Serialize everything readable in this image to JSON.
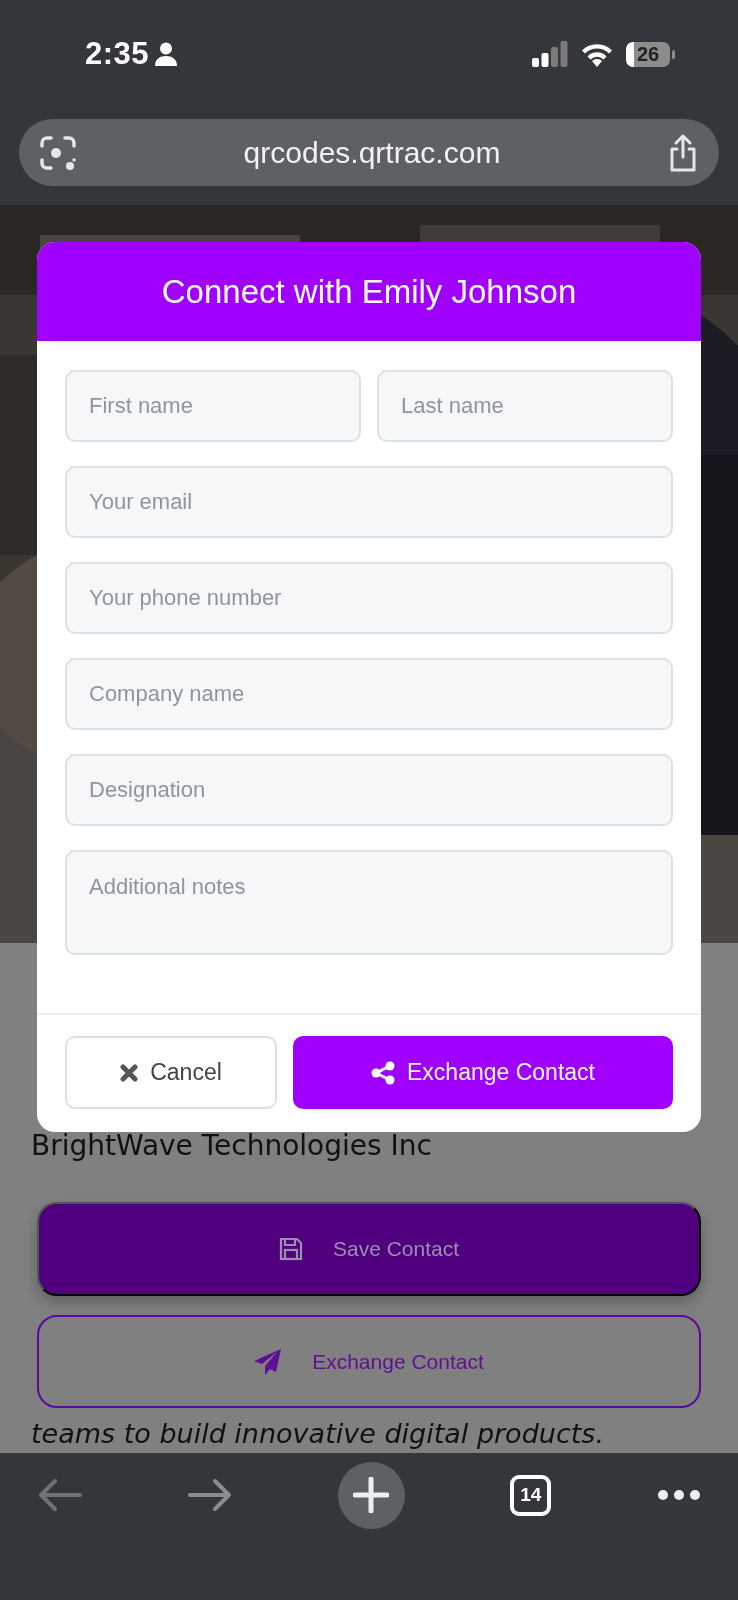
{
  "status_bar": {
    "time": "2:35",
    "battery": "26"
  },
  "address_bar": {
    "url": "qrcodes.qrtrac.com"
  },
  "modal": {
    "title": "Connect with Emily Johnson",
    "field_rows": [
      {
        "fields": [
          {
            "kind": "input",
            "placeholder": "First name"
          },
          {
            "kind": "input",
            "placeholder": "Last name"
          }
        ]
      },
      {
        "fields": [
          {
            "kind": "input",
            "placeholder": "Your email"
          }
        ]
      },
      {
        "fields": [
          {
            "kind": "input",
            "placeholder": "Your phone number"
          }
        ]
      },
      {
        "fields": [
          {
            "kind": "input",
            "placeholder": "Company name"
          }
        ]
      },
      {
        "fields": [
          {
            "kind": "input",
            "placeholder": "Designation"
          }
        ]
      },
      {
        "fields": [
          {
            "kind": "textarea",
            "placeholder": "Additional notes"
          }
        ]
      }
    ],
    "buttons": [
      {
        "kind": "cancel",
        "label": "Cancel"
      },
      {
        "kind": "primary",
        "label": "Exchange Contact"
      }
    ]
  },
  "page": {
    "company": "BrightWave Technologies Inc",
    "actions": [
      {
        "kind": "filled",
        "label": "Save Contact"
      },
      {
        "kind": "outline",
        "label": "Exchange Contact"
      }
    ],
    "bio_lines": [
      "teams to build innovative digital products."
    ]
  },
  "toolbar": {
    "tab_count": "14"
  }
}
